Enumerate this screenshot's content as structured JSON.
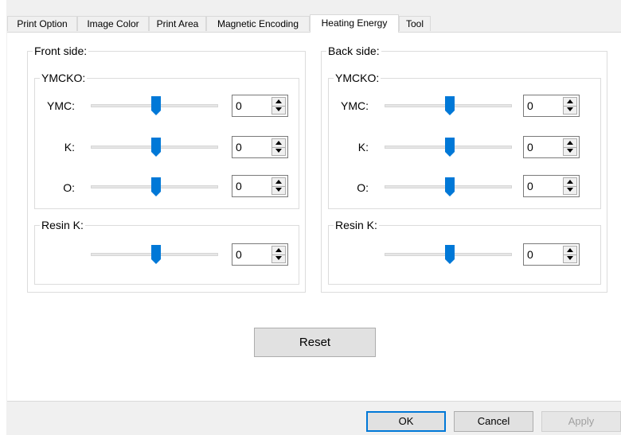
{
  "tabs": [
    {
      "label": "Print Option"
    },
    {
      "label": "Image Color"
    },
    {
      "label": "Print Area"
    },
    {
      "label": "Magnetic Encoding"
    },
    {
      "label": "Heating Energy"
    },
    {
      "label": "Tool"
    }
  ],
  "active_tab": "Heating Energy",
  "front": {
    "title": "Front side:",
    "ymcko_title": "YMCKO:",
    "ymc": {
      "label": "YMC:",
      "value": "0",
      "slider_level": 0.5
    },
    "k": {
      "label": "K:",
      "value": "0",
      "slider_level": 0.5
    },
    "o": {
      "label": "O:",
      "value": "0",
      "slider_level": 0.5
    },
    "resin_title": "Resin K:",
    "resin": {
      "value": "0",
      "slider_level": 0.5
    }
  },
  "back": {
    "title": "Back side:",
    "ymcko_title": "YMCKO:",
    "ymc": {
      "label": "YMC:",
      "value": "0",
      "slider_level": 0.5
    },
    "k": {
      "label": "K:",
      "value": "0",
      "slider_level": 0.5
    },
    "o": {
      "label": "O:",
      "value": "0",
      "slider_level": 0.5
    },
    "resin_title": "Resin K:",
    "resin": {
      "value": "0",
      "slider_level": 0.5
    }
  },
  "buttons": {
    "reset": "Reset",
    "ok": "OK",
    "cancel": "Cancel",
    "apply": "Apply"
  },
  "colors": {
    "slider_thumb": "#0078d7",
    "ok_border": "#0078d7"
  }
}
